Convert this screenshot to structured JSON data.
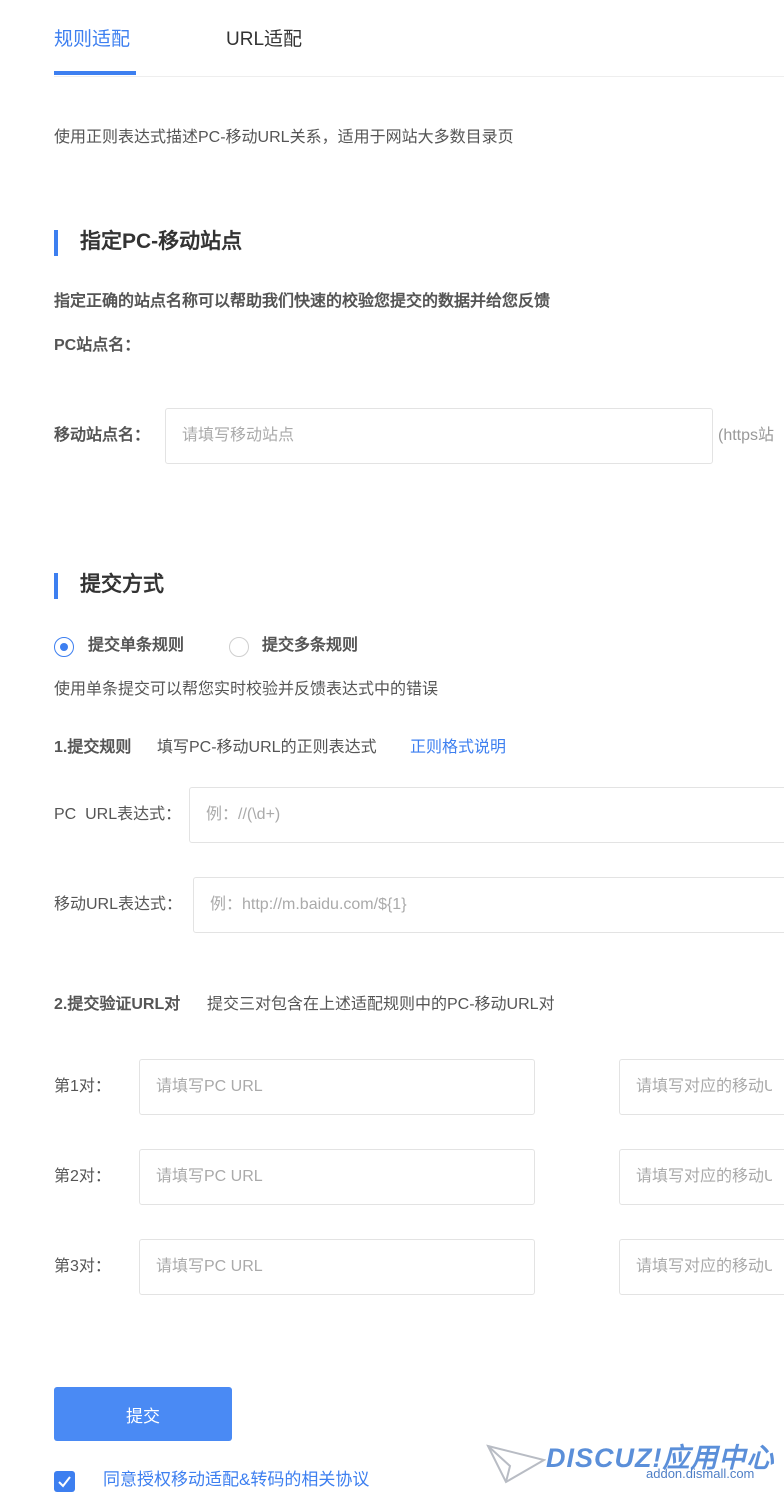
{
  "tabs": [
    {
      "label": "规则适配",
      "active": true
    },
    {
      "label": "URL适配",
      "active": false
    }
  ],
  "intro": "使用正则表达式描述PC-移动URL关系，适用于网站大多数目录页",
  "site_section": {
    "title": "指定PC-移动站点",
    "hint": "指定正确的站点名称可以帮助我们快速的校验您提交的数据并给您反馈",
    "pc_label": "PC站点名：",
    "mobile_label": "移动站点名：",
    "mobile_placeholder": "请填写移动站点",
    "mobile_suffix": "(https站"
  },
  "submit_section": {
    "title": "提交方式",
    "options": [
      "提交单条规则",
      "提交多条规则"
    ],
    "selected": "提交单条规则",
    "single_desc": "使用单条提交可以帮您实时校验并反馈表达式中的错误",
    "step1_title": "1.提交规则",
    "step1_desc": "填写PC-移动URL的正则表达式",
    "step1_link": "正则格式说明",
    "pc_url_label": "PC  URL表达式：",
    "pc_url_placeholder": "例：//(\\d+)",
    "mobile_url_label": "移动URL表达式：",
    "mobile_url_placeholder": "例：http://m.baidu.com/${1}",
    "step2_title": "2.提交验证URL对",
    "step2_desc": "提交三对包含在上述适配规则中的PC-移动URL对",
    "pairs": [
      {
        "label": "第1对：",
        "pc_placeholder": "请填写PC URL",
        "mobile_placeholder": "请填写对应的移动U"
      },
      {
        "label": "第2对：",
        "pc_placeholder": "请填写PC URL",
        "mobile_placeholder": "请填写对应的移动U"
      },
      {
        "label": "第3对：",
        "pc_placeholder": "请填写PC URL",
        "mobile_placeholder": "请填写对应的移动U"
      }
    ]
  },
  "submit_button": "提交",
  "agreement": {
    "checked": true,
    "text": "同意授权移动适配&转码的相关协议"
  },
  "watermark": {
    "brand": "DISCUZ!应用中心",
    "domain": "addon.dismall.com",
    "icon": "paper-plane-icon"
  },
  "colors": {
    "accent": "#3d7ff0",
    "button": "#4a8af4"
  }
}
